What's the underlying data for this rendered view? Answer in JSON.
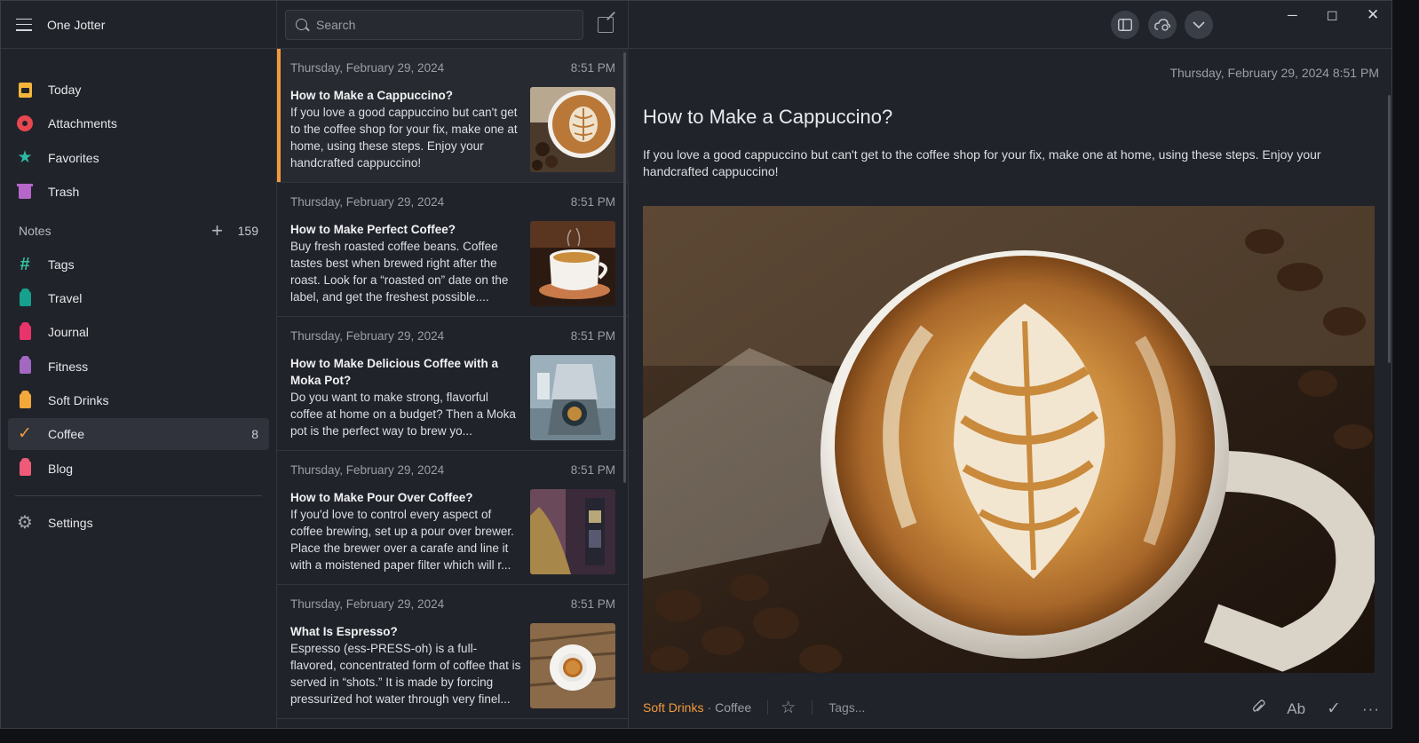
{
  "app": {
    "title": "One Jotter"
  },
  "sidebar": {
    "top_items": [
      {
        "label": "Today",
        "icon": "today-icon"
      },
      {
        "label": "Attachments",
        "icon": "attachments-icon"
      },
      {
        "label": "Favorites",
        "icon": "star-icon"
      },
      {
        "label": "Trash",
        "icon": "trash-icon"
      }
    ],
    "notes_section": {
      "label": "Notes",
      "count": "159"
    },
    "notebooks": [
      {
        "label": "Tags",
        "icon": "hash-icon"
      },
      {
        "label": "Travel",
        "icon": "tag-icon",
        "color": "#16a08d"
      },
      {
        "label": "Journal",
        "icon": "tag-icon",
        "color": "#e8336b"
      },
      {
        "label": "Fitness",
        "icon": "tag-icon",
        "color": "#a368c2"
      },
      {
        "label": "Soft Drinks",
        "icon": "tag-icon",
        "color": "#f2a93a"
      },
      {
        "label": "Coffee",
        "icon": "check-icon",
        "count": "8",
        "selected": true
      },
      {
        "label": "Blog",
        "icon": "tag-icon",
        "color": "#ee5a78"
      }
    ],
    "settings": {
      "label": "Settings",
      "icon": "gear-icon"
    }
  },
  "search": {
    "placeholder": "Search",
    "value": ""
  },
  "notes": [
    {
      "date": "Thursday, February 29, 2024",
      "time": "8:51 PM",
      "title": "How to Make a Cappuccino?",
      "snippet": "If you love a good cappuccino but can't get to the coffee shop for your fix, make one at home, using these steps. Enjoy your handcrafted cappuccino!",
      "thumb": "latte-art"
    },
    {
      "date": "Thursday, February 29, 2024",
      "time": "8:51 PM",
      "title": "How to Make Perfect Coffee?",
      "snippet": "Buy fresh roasted coffee beans. Coffee tastes best when brewed right after the roast. Look for a “roasted on” date on the label, and get the freshest possible....",
      "thumb": "coffee-cup"
    },
    {
      "date": "Thursday, February 29, 2024",
      "time": "8:51 PM",
      "title": "How to Make Delicious Coffee with a Moka Pot?",
      "snippet": "Do you want to make strong, flavorful coffee at home on a budget? Then a Moka pot is the perfect way to brew yo...",
      "thumb": "moka-pot"
    },
    {
      "date": "Thursday, February 29, 2024",
      "time": "8:51 PM",
      "title": "How to Make Pour Over Coffee?",
      "snippet": "If you'd love to control every aspect of coffee brewing, set up a pour over brewer. Place the brewer over a carafe and line it with a moistened paper filter which will r...",
      "thumb": "pour-over"
    },
    {
      "date": "Thursday, February 29, 2024",
      "time": "8:51 PM",
      "title": "What Is Espresso?",
      "snippet": "Espresso (ess-PRESS-oh) is a full-flavored, concentrated form of coffee that is served in “shots.” It is made by forcing pressurized hot water through very finel...",
      "thumb": "espresso"
    }
  ],
  "editor": {
    "datetime": "Thursday, February 29, 2024 8:51 PM",
    "title": "How to Make a Cappuccino?",
    "body": "If you love a good cappuccino but can't get to the coffee shop for your fix, make one at home, using these steps. Enjoy your handcrafted cappuccino!",
    "footer": {
      "notebook": "Soft Drinks",
      "separator": "·",
      "tag": "Coffee",
      "tags_placeholder": "Tags...",
      "font_label": "Ab"
    }
  },
  "colors": {
    "accent": "#f29a3c",
    "background": "#20232a",
    "panel": "#272a31"
  }
}
